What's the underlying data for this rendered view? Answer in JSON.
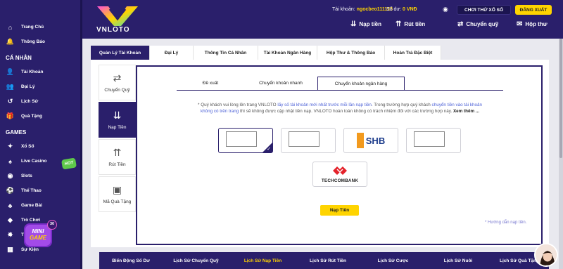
{
  "sidebar": {
    "items_top": [
      {
        "icon": "home-icon",
        "glyph": "⌂",
        "label": "Trang Chủ"
      },
      {
        "icon": "bell-icon",
        "glyph": "🔔",
        "label": "Thông Báo"
      }
    ],
    "section_personal": "CÁ NHÂN",
    "items_personal": [
      {
        "icon": "user-icon",
        "glyph": "👤",
        "label": "Tài Khoản"
      },
      {
        "icon": "agent-icon",
        "glyph": "👥",
        "label": "Đại Lý"
      },
      {
        "icon": "history-icon",
        "glyph": "↺",
        "label": "Lịch Sử"
      },
      {
        "icon": "gift-icon",
        "glyph": "🎁",
        "label": "Quà Tặng"
      }
    ],
    "section_games": "GAMES",
    "items_games": [
      {
        "icon": "lottery-icon",
        "glyph": "✦",
        "label": "Xổ Số"
      },
      {
        "icon": "live-casino-icon",
        "glyph": "♠",
        "label": "Live Casino"
      },
      {
        "icon": "slots-icon",
        "glyph": "◉",
        "label": "Slots"
      },
      {
        "icon": "sports-icon",
        "glyph": "⚽",
        "label": "Thể Thao"
      },
      {
        "icon": "card-game-icon",
        "glyph": "♣",
        "label": "Game Bài"
      },
      {
        "icon": "mini-game-icon",
        "glyph": "◆",
        "label": "Trò Chơi"
      },
      {
        "icon": "cockfight-icon",
        "glyph": "✸",
        "label": "Trực Tiếp Đá"
      },
      {
        "icon": "event-icon",
        "glyph": "▦",
        "label": "Sự Kiện"
      }
    ],
    "hot_badge": "HOT",
    "mini_game_badge": "30",
    "mini_game_text_1": "MINI",
    "mini_game_text_2": "GAME"
  },
  "header": {
    "logo_text": "VNLOTO",
    "account_label": "Tài khoản:",
    "account_value": "ngocbeo111123",
    "balance_label": "Số dư:",
    "balance_value": "0 VNĐ",
    "demo_button": "CHƠI THỬ XỔ SỐ",
    "logout_button": "ĐĂNG XUẤT",
    "nav": [
      {
        "icon": "deposit-icon",
        "glyph": "⇊",
        "label": "Nạp tiền"
      },
      {
        "icon": "withdraw-icon",
        "glyph": "⇈",
        "label": "Rút tiền"
      },
      {
        "icon": "transfer-icon",
        "glyph": "⇄",
        "label": "Chuyển quỹ"
      },
      {
        "icon": "mail-icon",
        "glyph": "✉",
        "label": "Hộp thư"
      }
    ]
  },
  "main_tabs": [
    "Quản Lý Tài Khoản",
    "Đại Lý",
    "Thông Tin Cá Nhân",
    "Tài Khoản Ngân Hàng",
    "Hộp Thư & Thông Báo",
    "Hoàn Trả Đặc Biệt"
  ],
  "vertical_tabs": [
    {
      "icon": "transfer-icon",
      "glyph": "⇄",
      "label": "Chuyển Quỹ"
    },
    {
      "icon": "deposit-icon",
      "glyph": "⇊",
      "label": "Nạp Tiền"
    },
    {
      "icon": "withdraw-icon",
      "glyph": "⇈",
      "label": "Rút Tiền"
    },
    {
      "icon": "gift-code-icon",
      "glyph": "▣",
      "label": "Mã Quà Tặng"
    }
  ],
  "sub_tabs": [
    "Đề xuất",
    "Chuyển khoản nhanh",
    "Chuyển khoản ngân hàng"
  ],
  "notice": {
    "p1": "* Quý khách vui lòng lên trang VNLOTO ",
    "link1": "lấy số tài khoản mới nhất trước mỗi lần nạp tiền",
    "p2": ". Trong trường hợp quý khách ",
    "link2": "chuyển tiền vào tài khoản không có trên trang",
    "p3": " thì sẽ không được cập nhật tiền nạp. VNLOTO hoàn toàn không có trách nhiệm đối với các trường hợp này. ",
    "more": "Xem thêm ..."
  },
  "banks": {
    "shb": "SHB",
    "techcombank": "TECHCOMBANK"
  },
  "submit_button": "Nạp Tiền",
  "guide_link": "* Hướng dẫn nạp tiền.",
  "bottom_bar": [
    "Biến Động Số Dư",
    "Lịch Sử Chuyển Quỹ",
    "Lịch Sử Nạp Tiền",
    "Lịch Sử Rút Tiền",
    "Lịch Sử Cược",
    "Lịch Sử Nuôi",
    "Lịch Sử Quà Tặng"
  ],
  "colors": {
    "brand": "#2a1f6b",
    "accent": "#ffd400"
  }
}
